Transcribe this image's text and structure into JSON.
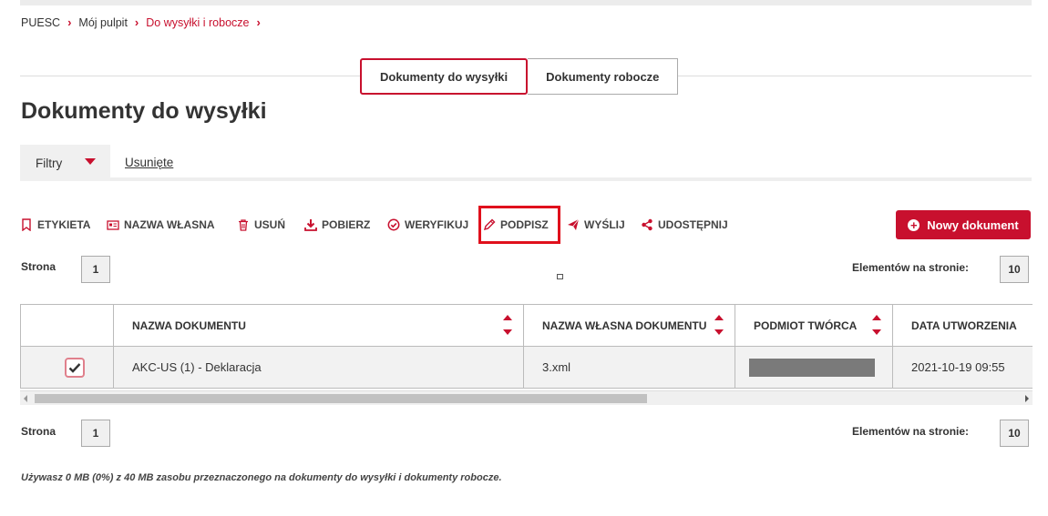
{
  "breadcrumb": {
    "items": [
      "PUESC",
      "Mój pulpit",
      "Do wysyłki i robocze"
    ]
  },
  "tabs": [
    {
      "label": "Dokumenty do wysyłki",
      "active": true
    },
    {
      "label": "Dokumenty robocze",
      "active": false
    }
  ],
  "page_title": "Dokumenty do wysyłki",
  "filters": {
    "filter_label": "Filtry",
    "removed_label": "Usunięte"
  },
  "toolbar": {
    "label_label": "ETYKIETA",
    "own_name_label": "NAZWA WŁASNA",
    "delete_label": "USUŃ",
    "download_label": "POBIERZ",
    "verify_label": "WERYFIKUJ",
    "sign_label": "PODPISZ",
    "send_label": "WYŚLIJ",
    "share_label": "UDOSTĘPNIJ"
  },
  "new_document_label": "Nowy dokument",
  "pager": {
    "page_label": "Strona",
    "page_value": "1",
    "per_page_label": "Elementów na stronie:",
    "per_page_value": "10"
  },
  "table": {
    "columns": [
      "NAZWA DOKUMENTU",
      "NAZWA WŁASNA DOKUMENTU",
      "PODMIOT TWÓRCA",
      "DATA UTWORZENIA"
    ],
    "rows": [
      {
        "checked": true,
        "name": "AKC-US (1) - Deklaracja",
        "own_name": "3.xml",
        "creator": "",
        "created": "2021-10-19 09:55"
      }
    ]
  },
  "usage_text": "Używasz 0 MB (0%) z 40 MB zasobu przeznaczonego na dokumenty do wysyłki i dokumenty robocze.",
  "colors": {
    "accent": "#c8102e",
    "highlight": "#e0101c"
  }
}
